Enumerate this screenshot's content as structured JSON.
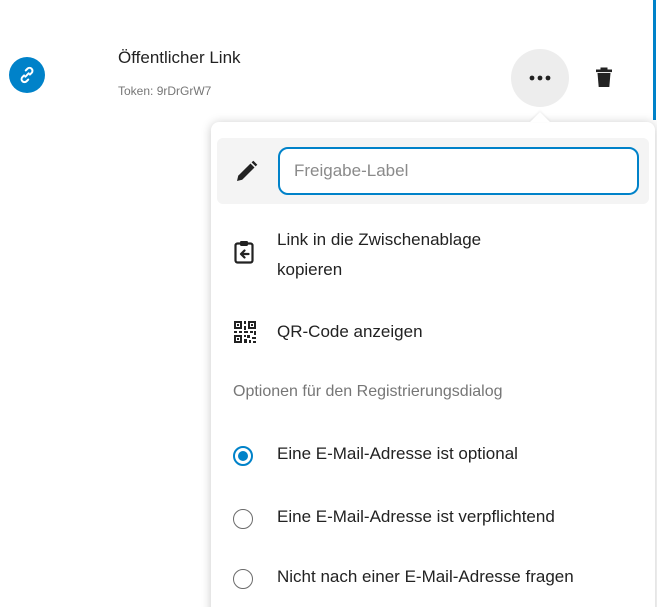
{
  "colors": {
    "accent": "#0082c9",
    "text": "#222222",
    "muted": "#767676"
  },
  "share": {
    "title": "Öffentlicher Link",
    "token": "Token: 9rDrGrW7",
    "avatar_icon": "link-icon",
    "more_icon": "more-horizontal-icon",
    "delete_icon": "trash-icon"
  },
  "menu": {
    "label_input": {
      "placeholder": "Freigabe-Label",
      "value": "",
      "icon": "pencil-icon"
    },
    "copy_link": {
      "line1": "Link in die Zwischenablage",
      "line2": "kopieren",
      "icon": "clipboard-icon"
    },
    "qr_code": {
      "label": "QR-Code anzeigen",
      "icon": "qrcode-icon"
    },
    "registration_caption": "Optionen für den Registrierungsdialog",
    "email_options": [
      {
        "label": "Eine E-Mail-Adresse ist optional",
        "checked": true
      },
      {
        "label": "Eine E-Mail-Adresse ist verpflichtend",
        "checked": false
      },
      {
        "label": "Nicht nach einer E-Mail-Adresse fragen",
        "checked": false
      }
    ]
  }
}
